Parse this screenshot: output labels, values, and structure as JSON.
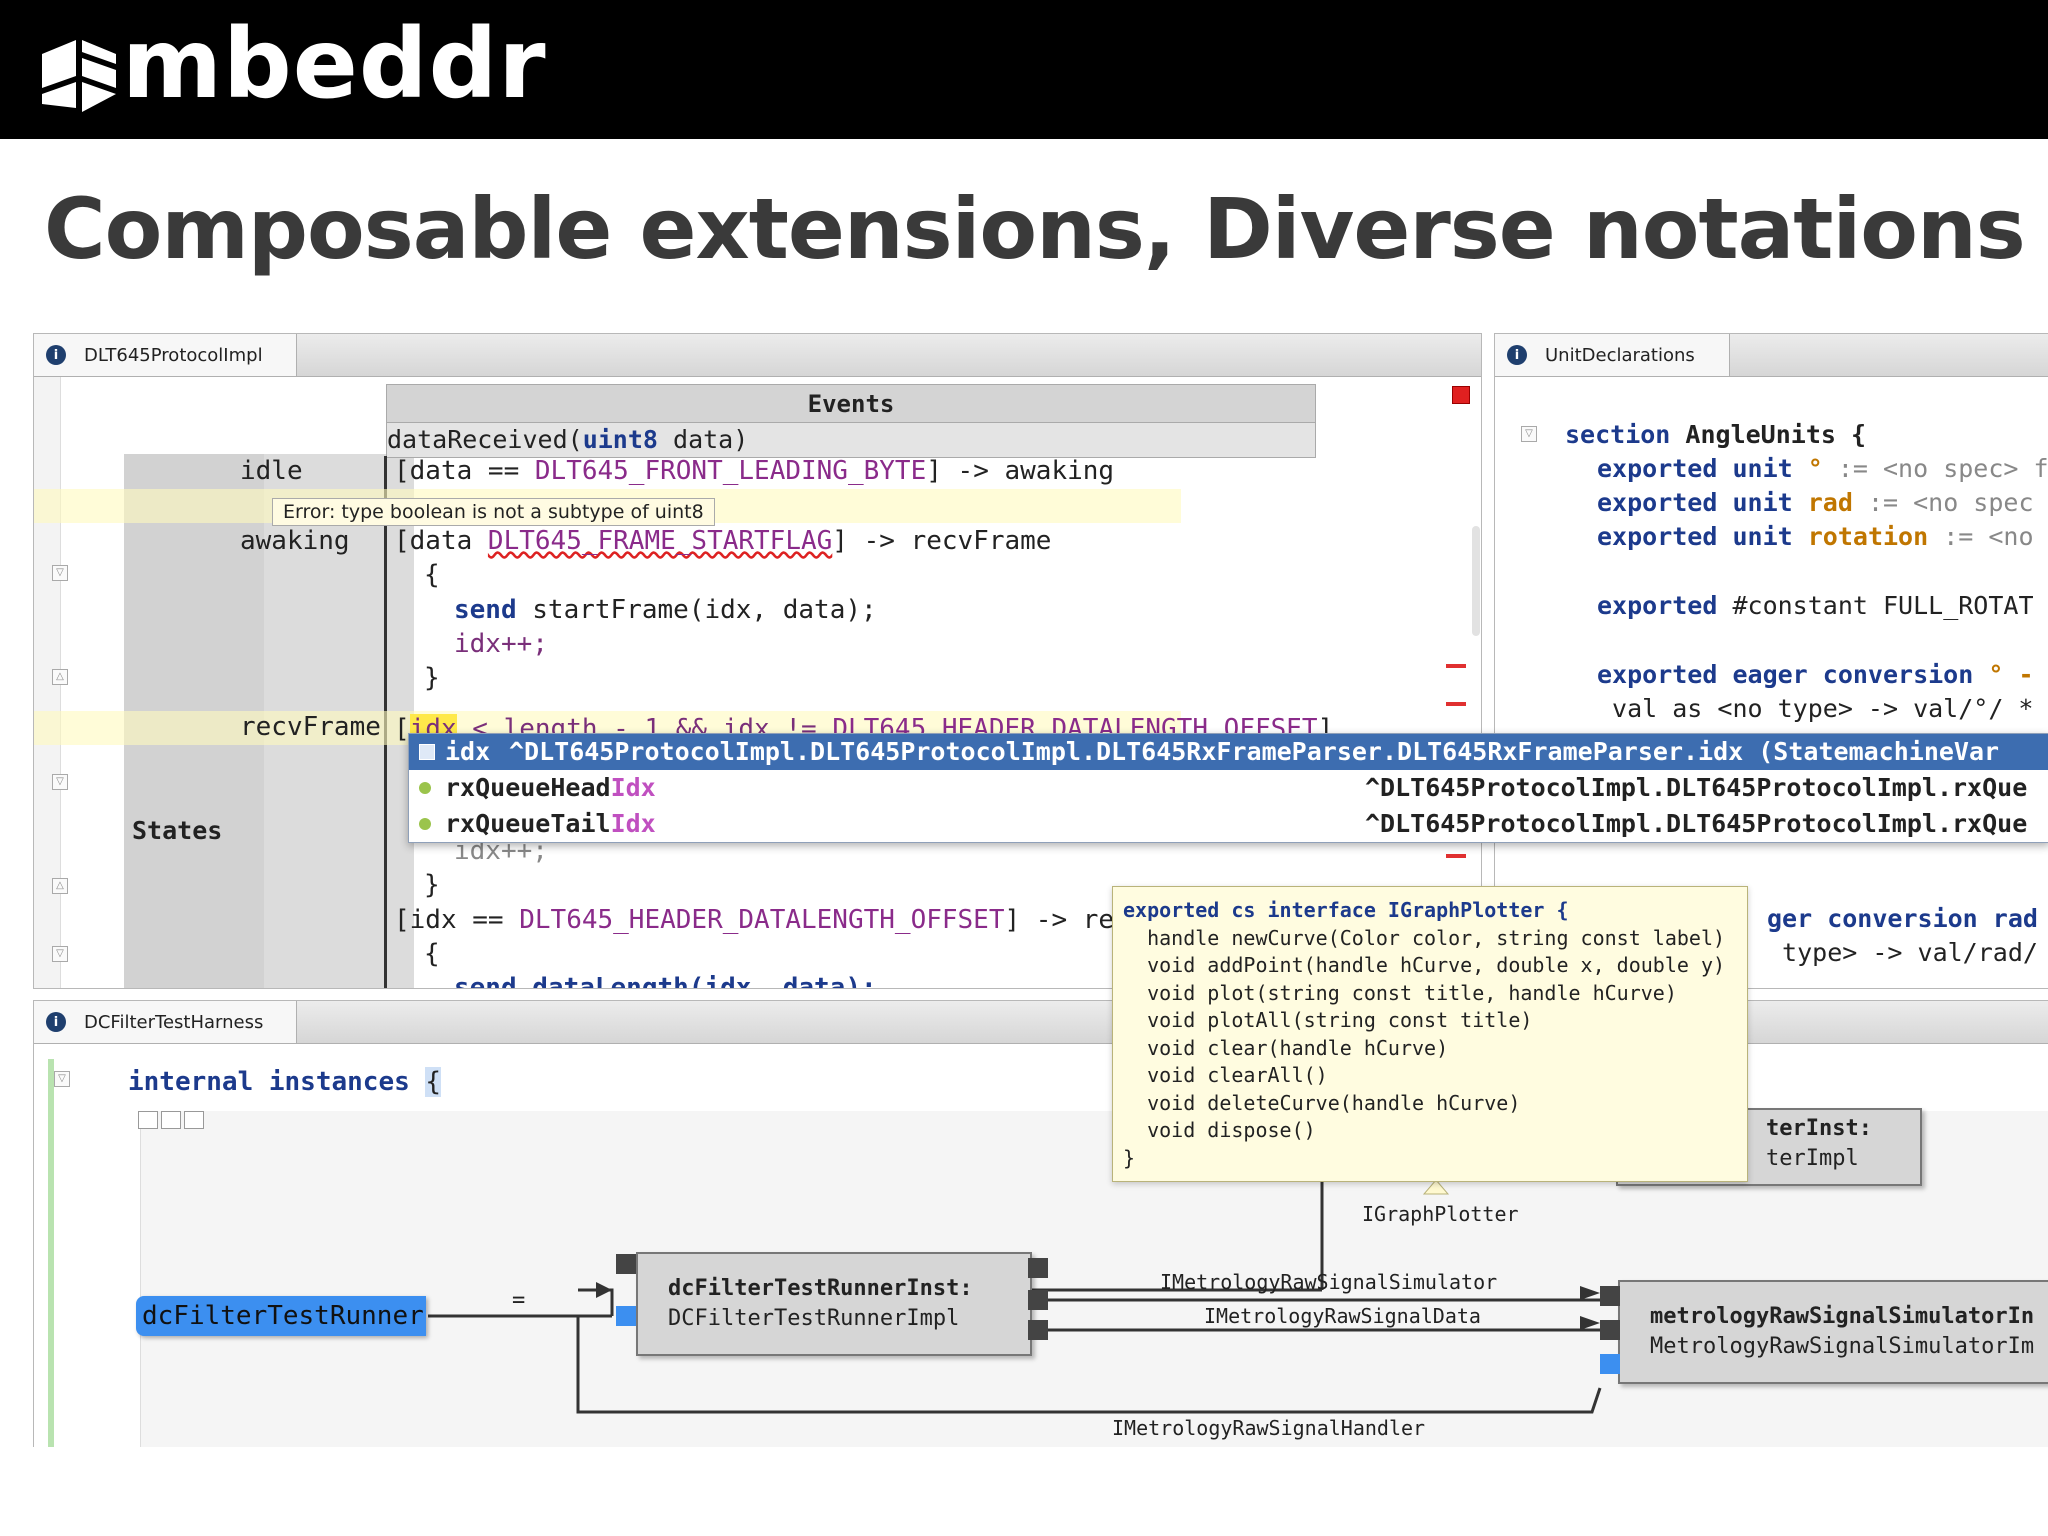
{
  "brand": {
    "name": "mbeddr"
  },
  "slide": {
    "title": "Composable extensions, Diverse notations"
  },
  "colors": {
    "keyword": "#1c3a8c",
    "constant": "#8a2b8a",
    "selection": "#3d6db0",
    "tooltip_bg": "#fffce0",
    "port_blue": "#3c8ff0"
  },
  "panes": {
    "protocol": {
      "tab": "DLT645ProtocolImpl",
      "events_header": "Events",
      "event_sig": {
        "name": "dataReceived",
        "type": "uint8",
        "param": "data"
      },
      "states_label": "States",
      "state_idle": "idle",
      "state_awaking": "awaking",
      "state_recvframe": "recvFrame",
      "error_tooltip": "Error: type boolean  is not a subtype of uint8",
      "lines": {
        "idle_guard_a": "[data == ",
        "idle_guard_const": "DLT645_FRONT_LEADING_BYTE",
        "idle_guard_b": "] -> awaking",
        "awaking_guard_a": "[data ",
        "awaking_guard_const": "DLT645_FRAME_STARTFLAG",
        "awaking_guard_b": "] -> recvFrame",
        "open_brace": "{",
        "send_kw": "send",
        "send_call": " startFrame(idx, data);",
        "idx_inc": "idx++;",
        "close_brace": "}",
        "recv_guard_open": "[",
        "recv_guard_cursor": "idx",
        "recv_guard_mid": " < length - 1 && idx != ",
        "recv_guard_const": "DLT645_HEADER_DATALENGTH_OFFSET",
        "recv_guard_close": "]",
        "idx_inc2": "idx++;",
        "close_brace2": "}",
        "guard3_a": "[idx == ",
        "guard3_const": "DLT645_HEADER_DATALENGTH_OFFSET",
        "guard3_b": "] -> rec",
        "open_brace3": "{",
        "send_datalength": "send dataLength(idx, data);"
      }
    },
    "units": {
      "tab": "UnitDeclarations",
      "section_kw": "section",
      "section_name": "AngleUnits {",
      "line1_kw": "exported unit",
      "line1_name": "°",
      "line1_rest": " := <no spec> f",
      "line2_kw": "exported unit",
      "line2_name": "rad",
      "line2_rest": " := <no spec",
      "line3_kw": "exported unit",
      "line3_name": "rotation",
      "line3_rest": " := <no",
      "line4_kw": "exported",
      "line4_rest": " #constant FULL_ROTAT",
      "line5_kw": "exported eager conversion",
      "line5_rest": " ° -",
      "line6": " val as <no type> -> val/°/ *",
      "close": "}",
      "line7": "ger conversion rad",
      "line8": " type> -> val/rad/"
    },
    "harness": {
      "tab": "DCFilterTestHarness",
      "header_kw": "internal instances",
      "header_brace": "{"
    }
  },
  "completion": {
    "items": [
      {
        "name": "idx",
        "path": "^DLT645ProtocolImpl.DLT645ProtocolImpl.DLT645RxFrameParser.DLT645RxFrameParser.idx (StatemachineVar"
      },
      {
        "name_a": "rxQueueHead",
        "name_hl": "Idx",
        "path": "^DLT645ProtocolImpl.DLT645ProtocolImpl.rxQue"
      },
      {
        "name_a": "rxQueueTail",
        "name_hl": "Idx",
        "path": "^DLT645ProtocolImpl.DLT645ProtocolImpl.rxQue"
      }
    ]
  },
  "interface_tooltip": {
    "header": "exported cs interface IGraphPlotter {",
    "methods": [
      "  handle newCurve(Color color, string const label)",
      "  void addPoint(handle hCurve, double x, double y)",
      "  void plot(string const title, handle hCurve)",
      "  void plotAll(string const title)",
      "  void clear(handle hCurve)",
      "  void clearAll()",
      "  void deleteCurve(handle hCurve)",
      "  void dispose()"
    ],
    "footer": "}"
  },
  "diagram": {
    "runner_label": "dcFilterTestRunner",
    "equals": "=",
    "runner_inst_line1": "dcFilterTestRunnerInst:",
    "runner_inst_line2": "DCFilterTestRunnerImpl",
    "simulator_line1": "metrologyRawSignalSimulatorIn",
    "simulator_line2": "MetrologyRawSignalSimulatorIm",
    "plotter_line1": "terInst:",
    "plotter_line2": "terImpl",
    "wires": {
      "plotter": "IGraphPlotter",
      "sim": "IMetrologyRawSignalSimulator",
      "data": "IMetrologyRawSignalData",
      "handler": "IMetrologyRawSignalHandler"
    }
  }
}
